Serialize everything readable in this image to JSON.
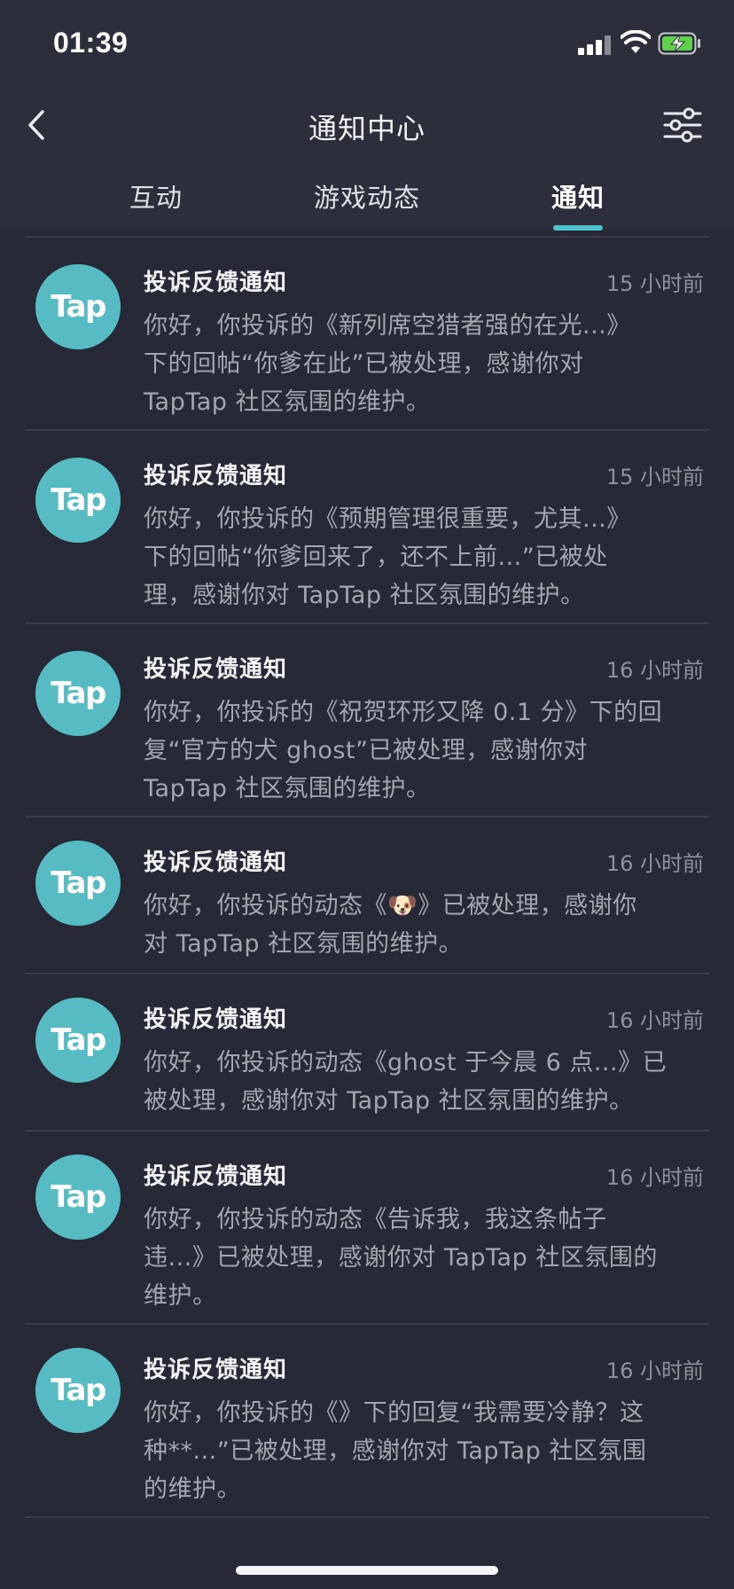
{
  "status_bar": {
    "time": "01:39"
  },
  "header": {
    "title": "通知中心",
    "back_icon": "chevron-left-icon",
    "filter_icon": "sliders-icon"
  },
  "tabs": [
    {
      "label": "互动",
      "active": false
    },
    {
      "label": "游戏动态",
      "active": false
    },
    {
      "label": "通知",
      "active": true
    }
  ],
  "accent_color": "#4ec2cb",
  "avatar_color": "#57bbc4",
  "notifications": [
    {
      "avatar_text": "Tap",
      "title": "投诉反馈通知",
      "time": "15 小时前",
      "lines": [
        "你好，你投诉的《新列席空猎者强的在光...》",
        "下的回帖“你爹在此”已被处理，感谢你对",
        "TapTap 社区氛围的维护。"
      ]
    },
    {
      "avatar_text": "Tap",
      "title": "投诉反馈通知",
      "time": "15 小时前",
      "lines": [
        "你好，你投诉的《预期管理很重要，尤其...》",
        "下的回帖“你爹回来了，还不上前...”已被处",
        "理，感谢你对 TapTap 社区氛围的维护。"
      ]
    },
    {
      "avatar_text": "Tap",
      "title": "投诉反馈通知",
      "time": "16 小时前",
      "lines": [
        "你好，你投诉的《祝贺环形又降 0.1 分》下的回",
        "复“官方的犬 ghost”已被处理，感谢你对",
        "TapTap 社区氛围的维护。"
      ]
    },
    {
      "avatar_text": "Tap",
      "title": "投诉反馈通知",
      "time": "16 小时前",
      "lines": [
        "你好，你投诉的动态《🐶》已被处理，感谢你",
        "对 TapTap 社区氛围的维护。"
      ]
    },
    {
      "avatar_text": "Tap",
      "title": "投诉反馈通知",
      "time": "16 小时前",
      "lines": [
        "你好，你投诉的动态《ghost 于今晨 6 点...》已",
        "被处理，感谢你对 TapTap 社区氛围的维护。"
      ]
    },
    {
      "avatar_text": "Tap",
      "title": "投诉反馈通知",
      "time": "16 小时前",
      "lines": [
        "你好，你投诉的动态《告诉我，我这条帖子",
        "违...》已被处理，感谢你对 TapTap 社区氛围的",
        "维护。"
      ]
    },
    {
      "avatar_text": "Tap",
      "title": "投诉反馈通知",
      "time": "16 小时前",
      "lines": [
        "你好，你投诉的《》下的回复“我需要冷静？这",
        "种**...”已被处理，感谢你对 TapTap 社区氛围",
        "的维护。"
      ]
    }
  ]
}
